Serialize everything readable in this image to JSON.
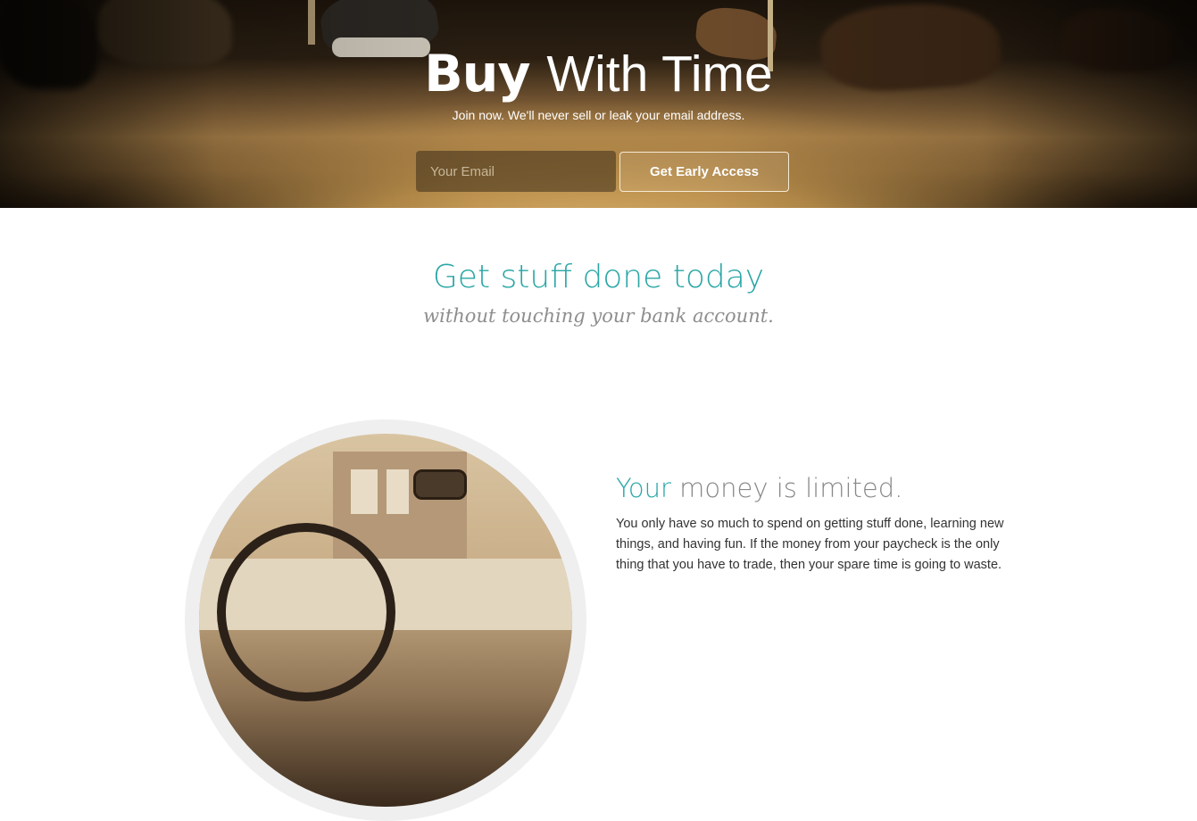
{
  "hero": {
    "title_bold": "Buy",
    "title_light": "With Time",
    "subtitle": "Join now. We'll never sell or leak your email address.",
    "email_placeholder": "Your Email",
    "cta_label": "Get Early Access"
  },
  "tagline": {
    "title": "Get stuff done today",
    "subtitle": "without touching your bank account."
  },
  "feature": {
    "title_accent": "Your",
    "title_rest": "money is limited.",
    "body": "You only have so much to spend on getting stuff done, learning new things, and having fun. If the money from your paycheck is the only thing that you have to trade, then your spare time is going to waste."
  },
  "colors": {
    "accent": "#2aa6a6",
    "muted_text": "#888888",
    "body_text": "#333333"
  }
}
